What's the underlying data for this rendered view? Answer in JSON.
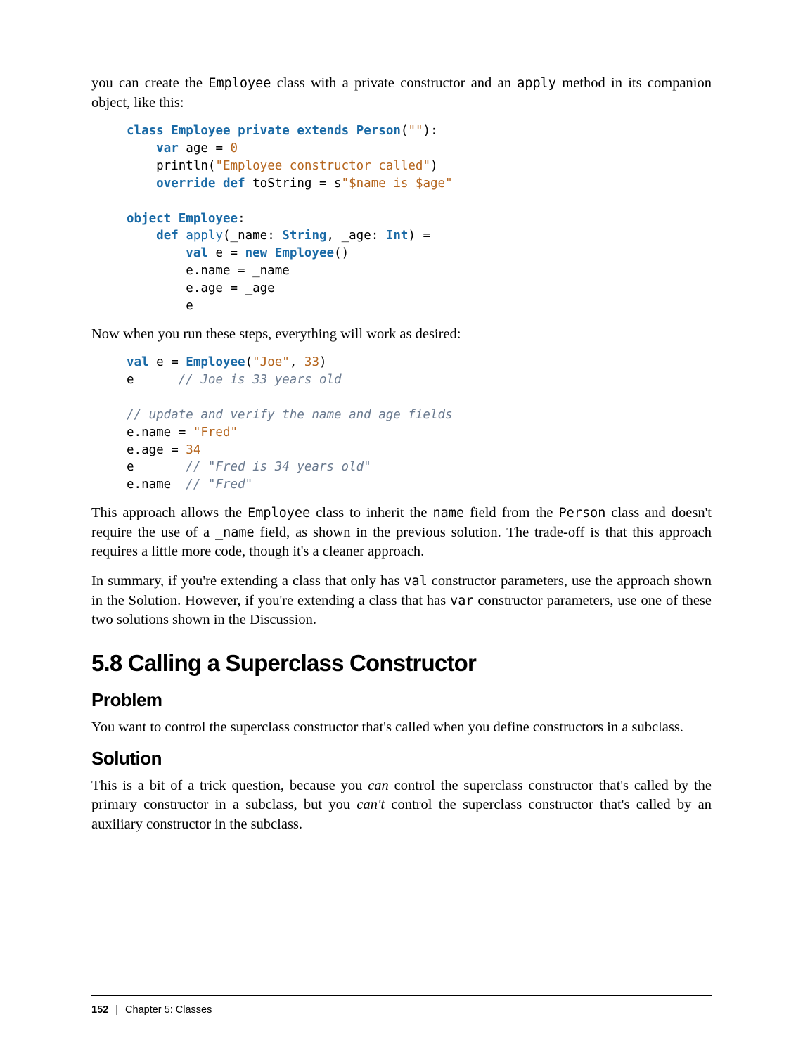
{
  "para1_a": "you can create the ",
  "para1_code1": "Employee",
  "para1_b": " class with a private constructor and an ",
  "para1_code2": "apply",
  "para1_c": " method in its companion object, like this:",
  "code1": {
    "l1_kw1": "class",
    "l1_type1": "Employee",
    "l1_kw2": "private",
    "l1_kw3": "extends",
    "l1_type2": "Person",
    "l1_str": "\"\"",
    "l2_kw": "var",
    "l2_id": " age = ",
    "l2_num": "0",
    "l3_a": "    println(",
    "l3_str": "\"Employee constructor called\"",
    "l3_b": ")",
    "l4_kw1": "override",
    "l4_kw2": "def",
    "l4_id": " toString = s",
    "l4_str": "\"$name is $age\"",
    "l5_kw": "object",
    "l5_type": "Employee",
    "l6_kw": "def",
    "l6_fn": "apply",
    "l6_a": "(_name: ",
    "l6_type1": "String",
    "l6_b": ", _age: ",
    "l6_type2": "Int",
    "l6_c": ") =",
    "l7_kw": "val",
    "l7_a": " e = ",
    "l7_kw2": "new",
    "l7_type": "Employee",
    "l8": "        e.name = _name",
    "l9": "        e.age = _age",
    "l10": "        e"
  },
  "para2": "Now when you run these steps, everything will work as desired:",
  "code2": {
    "l1_kw": "val",
    "l1_a": " e = ",
    "l1_type": "Employee",
    "l1_b": "(",
    "l1_str": "\"Joe\"",
    "l1_c": ", ",
    "l1_num": "33",
    "l1_d": ")",
    "l2_a": "e      ",
    "l2_comment": "// Joe is 33 years old",
    "l3_comment": "// update and verify the name and age fields",
    "l4_a": "e.name = ",
    "l4_str": "\"Fred\"",
    "l5_a": "e.age = ",
    "l5_num": "34",
    "l6_a": "e       ",
    "l6_comment": "// \"Fred is 34 years old\"",
    "l7_a": "e.name  ",
    "l7_comment": "// \"Fred\""
  },
  "para3_a": "This approach allows the ",
  "para3_code1": "Employee",
  "para3_b": " class to inherit the ",
  "para3_code2": "name",
  "para3_c": " field from the ",
  "para3_code3": "Person",
  "para3_d": " class and doesn't require the use of a ",
  "para3_code4": "_name",
  "para3_e": " field, as shown in the previous solution. The trade-off is that this approach requires a little more code, though it's a cleaner approach.",
  "para4_a": "In summary, if you're extending a class that only has ",
  "para4_code1": "val",
  "para4_b": " constructor parameters, use the approach shown in the Solution. However, if you're extending a class that has ",
  "para4_code2": "var",
  "para4_c": " constructor parameters, use one of these two solutions shown in the Discussion.",
  "section_title": "5.8 Calling a Superclass Constructor",
  "problem_title": "Problem",
  "problem_para": "You want to control the superclass constructor that's called when you define constructors in a subclass.",
  "solution_title": "Solution",
  "solution_para_a": "This is a bit of a trick question, because you ",
  "solution_para_em1": "can",
  "solution_para_b": " control the superclass constructor that's called by the primary constructor in a subclass, but you ",
  "solution_para_em2": "can't",
  "solution_para_c": " control the superclass constructor that's called by an auxiliary constructor in the subclass.",
  "footer_page": "152",
  "footer_sep": "|",
  "footer_chapter": "Chapter 5: Classes"
}
